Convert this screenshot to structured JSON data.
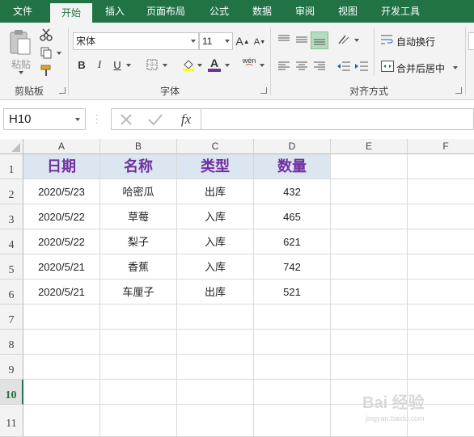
{
  "tabs": [
    "文件",
    "开始",
    "插入",
    "页面布局",
    "公式",
    "数据",
    "审阅",
    "视图",
    "开发工具"
  ],
  "ribbon": {
    "clipboard": {
      "paste_label": "粘贴",
      "group_label": "剪贴板"
    },
    "font": {
      "font_name": "宋体",
      "font_size": "11",
      "bold": "B",
      "italic": "I",
      "underline": "U",
      "font_color_glyph": "A",
      "phonetic_glyph": "wén",
      "group_label": "字体",
      "font_color": "#7030a0"
    },
    "alignment": {
      "wrap_text": "自动换行",
      "merge_center": "合并后居中",
      "group_label": "对齐方式"
    }
  },
  "formula_bar": {
    "name_box": "H10",
    "fx": "fx",
    "formula": ""
  },
  "columns": [
    "A",
    "B",
    "C",
    "D",
    "E",
    "F"
  ],
  "rows": [
    "1",
    "2",
    "3",
    "4",
    "5",
    "6",
    "7",
    "8",
    "9",
    "10",
    "11"
  ],
  "selected_row": "10",
  "sheet": {
    "header": [
      "日期",
      "名称",
      "类型",
      "数量"
    ],
    "data": [
      [
        "2020/5/23",
        "哈密瓜",
        "出库",
        "432"
      ],
      [
        "2020/5/22",
        "草莓",
        "入库",
        "465"
      ],
      [
        "2020/5/22",
        "梨子",
        "入库",
        "621"
      ],
      [
        "2020/5/21",
        "香蕉",
        "入库",
        "742"
      ],
      [
        "2020/5/21",
        "车厘子",
        "出库",
        "521"
      ]
    ],
    "header_fill": "#dce6f1",
    "header_text_color": "#7030a0"
  },
  "watermark": {
    "brand": "Bai 经验",
    "url": "jingyan.baidu.com"
  }
}
